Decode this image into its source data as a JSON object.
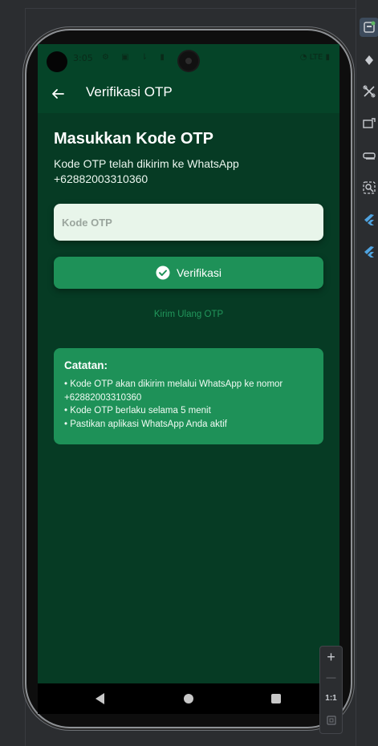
{
  "statusbar": {
    "time": "3:05",
    "icons": "⚙ ▣ ⇂ ▮",
    "right": "◔ LTE ▮"
  },
  "appbar": {
    "title": "Verifikasi OTP"
  },
  "content": {
    "heading": "Masukkan Kode OTP",
    "subtitle": "Kode OTP telah dikirim ke WhatsApp +62882003310360",
    "otp_placeholder": "Kode OTP",
    "verify_label": "Verifikasi",
    "resend_label": "Kirim Ulang OTP"
  },
  "note": {
    "title": "Catatan:",
    "lines": [
      "• Kode OTP akan dikirim melalui WhatsApp ke nomor +62882003310360",
      "• Kode OTP berlaku selama 5 menit",
      "• Pastikan aplikasi WhatsApp Anda aktif"
    ]
  },
  "zoom": {
    "in": "+",
    "out": "—",
    "ratio": "1:1"
  },
  "colors": {
    "background": "#063b24",
    "primary": "#1e9158",
    "appbar": "#054428",
    "input": "#e8f5ea"
  }
}
